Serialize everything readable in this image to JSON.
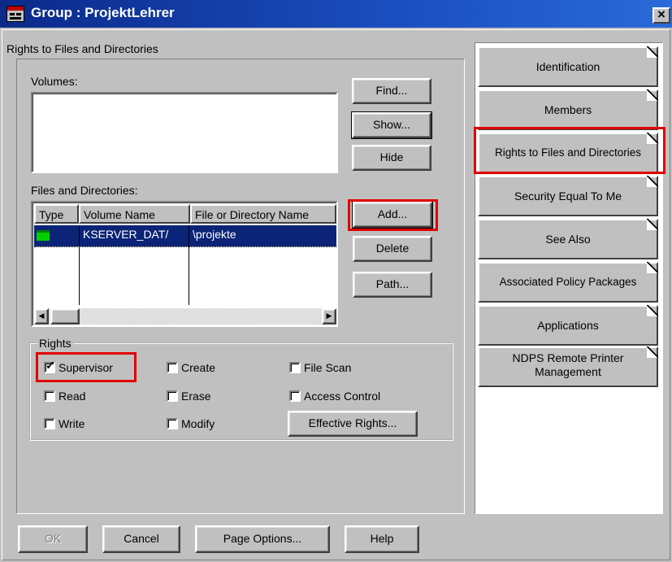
{
  "window": {
    "title": "Group : ProjektLehrer",
    "close_glyph": "×"
  },
  "main": {
    "section_title": "Rights to Files and Directories",
    "volumes_label": "Volumes:",
    "files_label": "Files and Directories:",
    "buttons": {
      "find": "Find...",
      "show": "Show...",
      "hide": "Hide",
      "add": "Add...",
      "delete": "Delete",
      "path": "Path..."
    },
    "table": {
      "columns": [
        "Type",
        "Volume Name",
        "File or Directory Name"
      ],
      "rows": [
        {
          "type_icon": "folder-icon",
          "volume": "KSERVER_DAT/",
          "path": "\\projekte"
        }
      ],
      "scroll_left": "◀",
      "scroll_right": "▶"
    },
    "rights": {
      "legend": "Rights",
      "supervisor": "Supervisor",
      "read": "Read",
      "write": "Write",
      "create": "Create",
      "erase": "Erase",
      "modify": "Modify",
      "file_scan": "File Scan",
      "access_control": "Access Control",
      "effective_rights": "Effective Rights...",
      "checked": {
        "supervisor": true,
        "read": false,
        "write": false,
        "create": false,
        "erase": false,
        "modify": false,
        "file_scan": false,
        "access_control": false
      }
    }
  },
  "footer": {
    "ok": "OK",
    "cancel": "Cancel",
    "page_options": "Page Options...",
    "help": "Help"
  },
  "tabs": [
    {
      "label": "Identification"
    },
    {
      "label": "Members"
    },
    {
      "label": "Rights to Files and Directories"
    },
    {
      "label": "Security Equal To Me"
    },
    {
      "label": "See Also"
    },
    {
      "label": "Associated Policy Packages"
    },
    {
      "label": "Applications"
    },
    {
      "label_line1": "NDPS Remote Printer",
      "label_line2": "Management"
    }
  ],
  "colors": {
    "title_bar": "#0b2a8a",
    "selection": "#0b2477",
    "highlight": "#e00000",
    "folder": "#00d000"
  }
}
